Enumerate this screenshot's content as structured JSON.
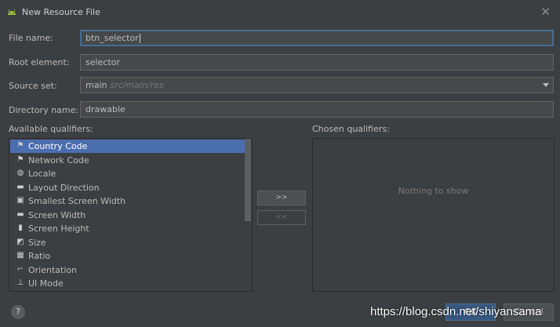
{
  "window": {
    "title": "New Resource File",
    "close_glyph": "✕"
  },
  "form": {
    "file_name": {
      "label": "File name:",
      "value": "btn_selector"
    },
    "root_element": {
      "label": "Root element:",
      "value": "selector"
    },
    "source_set": {
      "label": "Source set:",
      "value": "main",
      "hint": "src/main/res"
    },
    "directory_name": {
      "label": "Directory name:",
      "value": "drawable"
    }
  },
  "available": {
    "label": "Available qualifiers:",
    "items": [
      {
        "label": "Country Code",
        "icon": "country-code-icon",
        "glyph": "⚑",
        "selected": true
      },
      {
        "label": "Network Code",
        "icon": "network-code-icon",
        "glyph": "⚑"
      },
      {
        "label": "Locale",
        "icon": "locale-globe-icon",
        "glyph": "◍"
      },
      {
        "label": "Layout Direction",
        "icon": "layout-direction-icon",
        "glyph": "▬"
      },
      {
        "label": "Smallest Screen Width",
        "icon": "smallest-screen-width-icon",
        "glyph": "▣"
      },
      {
        "label": "Screen Width",
        "icon": "screen-width-icon",
        "glyph": "▬"
      },
      {
        "label": "Screen Height",
        "icon": "screen-height-icon",
        "glyph": "▮"
      },
      {
        "label": "Size",
        "icon": "size-icon",
        "glyph": "◩"
      },
      {
        "label": "Ratio",
        "icon": "ratio-icon",
        "glyph": "▦"
      },
      {
        "label": "Orientation",
        "icon": "orientation-icon",
        "glyph": "⌐"
      },
      {
        "label": "UI Mode",
        "icon": "ui-mode-icon",
        "glyph": "⊥"
      }
    ]
  },
  "buttons": {
    "add": ">>",
    "remove": "<<",
    "help": "?",
    "ok": "OK",
    "cancel": "Cancel"
  },
  "chosen": {
    "label": "Chosen qualifiers:",
    "empty_text": "Nothing to show"
  },
  "watermark": "https://blog.csdn.net/shiyansama",
  "colors": {
    "background": "#3c3f41",
    "selection": "#4b6eaf",
    "focus_border": "#466d94",
    "ok_button": "#365880",
    "android_green": "#a4c639"
  }
}
